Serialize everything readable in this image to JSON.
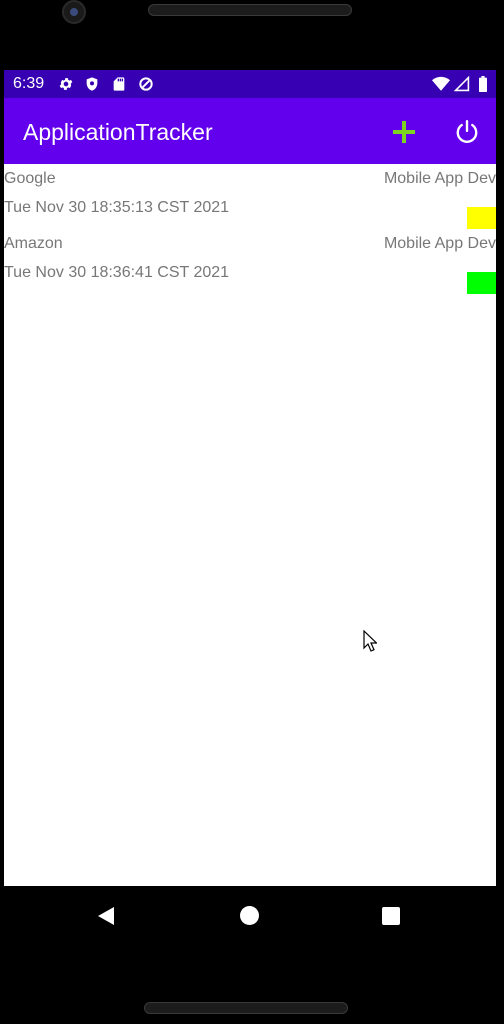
{
  "status_bar": {
    "time": "6:39",
    "left_icons": [
      "gear-icon",
      "shield-icon",
      "sd-card-icon",
      "data-saver-icon"
    ],
    "right_icons": [
      "wifi-icon",
      "cell-signal-icon",
      "battery-icon"
    ]
  },
  "app_bar": {
    "title": "ApplicationTracker",
    "add_icon": "plus-icon",
    "power_icon": "power-icon",
    "add_color": "#7ed321",
    "background": "#6200ee"
  },
  "applications": [
    {
      "company": "Google",
      "position": "Mobile App Dev",
      "date": "Tue Nov 30 18:35:13 CST 2021",
      "status_color": "#ffff00"
    },
    {
      "company": "Amazon",
      "position": "Mobile App Dev",
      "date": "Tue Nov 30 18:36:41 CST 2021",
      "status_color": "#00ff00"
    }
  ],
  "nav_bar": {
    "back_icon": "back-triangle-icon",
    "home_icon": "home-circle-icon",
    "recents_icon": "recents-square-icon"
  }
}
